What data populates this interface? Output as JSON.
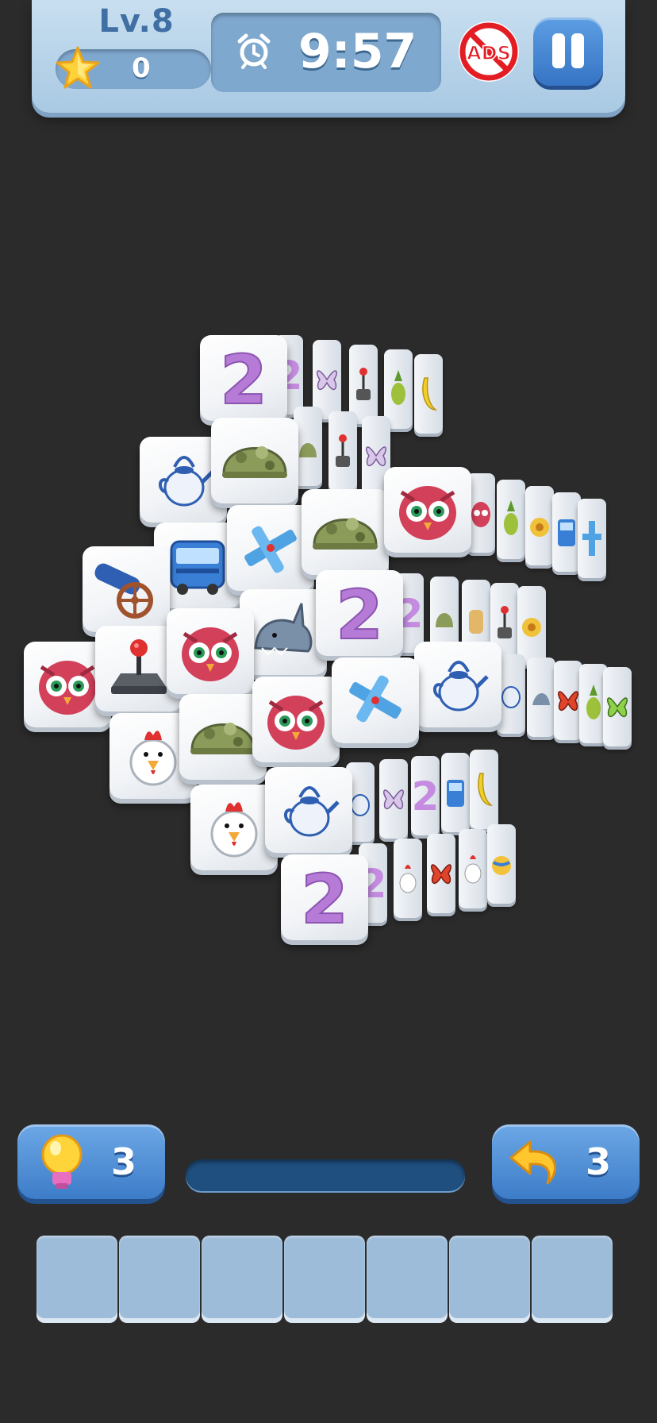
{
  "hud": {
    "level_label": "Lv.8",
    "stars": "0",
    "timer": "9:57",
    "remove_ads_label": "ADS",
    "icons": [
      "star-icon",
      "alarm-clock-icon",
      "no-ads-icon",
      "pause-icon"
    ]
  },
  "board": {
    "tiles": [
      "2",
      "owl",
      "teapot",
      "helmet",
      "cannon",
      "bus",
      "plane",
      "joystick",
      "shark",
      "chicken",
      "butterfly",
      "pineapple",
      "banana"
    ]
  },
  "boosters": {
    "hint_count": "3",
    "undo_count": "3"
  },
  "tray": {
    "slot_count": 7
  },
  "colors": {
    "background": "#2b2b2b",
    "hud": "#b8d4ea",
    "button_blue": "#3d7cc8",
    "tile": "#ffffff"
  }
}
